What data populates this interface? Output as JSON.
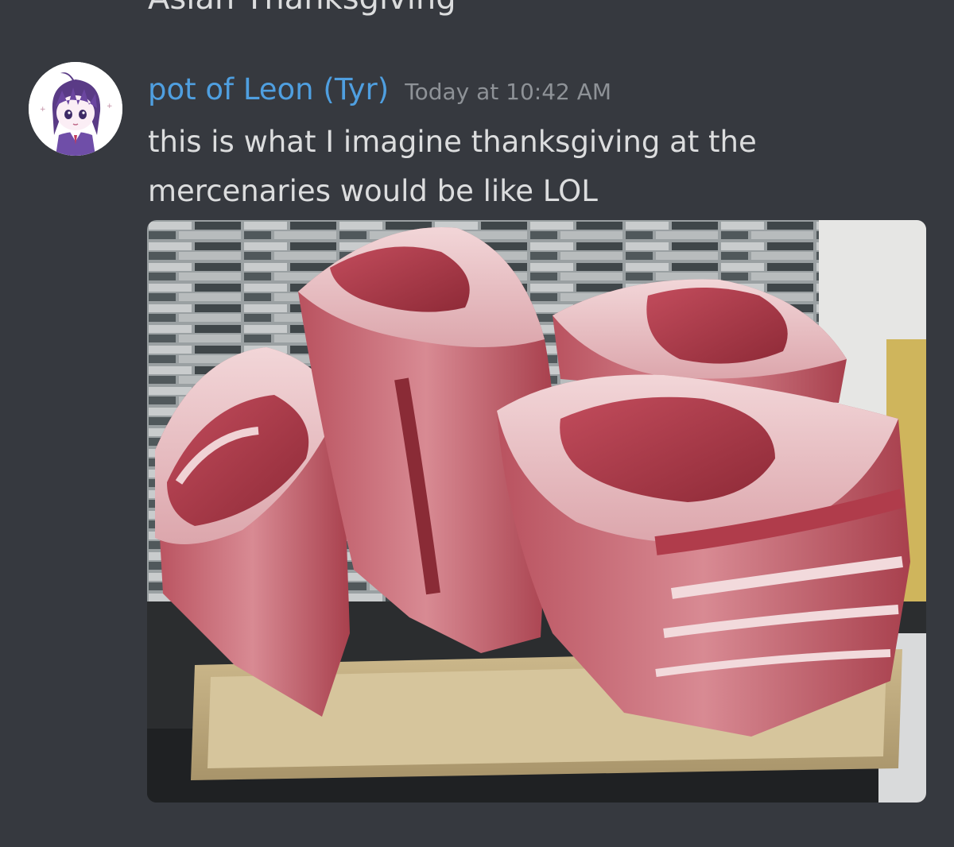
{
  "previous_message": {
    "text": "Asian Thanksgiving"
  },
  "message": {
    "username": "pot of Leon (Tyr)",
    "timestamp": "Today at 10:42 AM",
    "text": "this is what I imagine thanksgiving at the mercenaries would be like LOL",
    "avatar": "anime-character-avatar",
    "attachment": {
      "kind": "photo",
      "subject": "raw-prime-rib-roasts-photo"
    }
  },
  "colors": {
    "background": "#36393f",
    "username": "#4f9fe0",
    "text": "#dcddde",
    "timestamp": "#8e9297"
  }
}
